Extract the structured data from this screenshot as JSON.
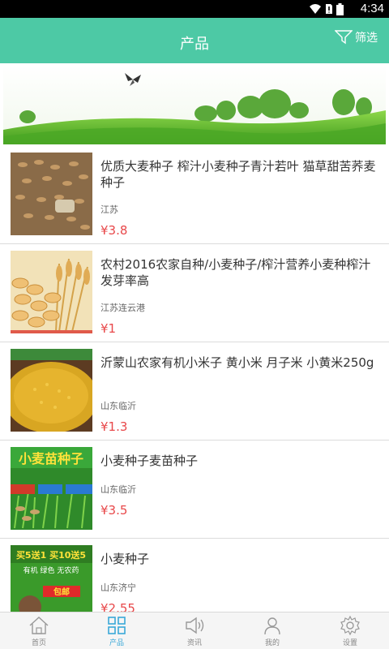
{
  "status_bar": {
    "time": "4:34"
  },
  "header": {
    "title": "产品",
    "filter_label": "筛选"
  },
  "products": [
    {
      "name": "优质大麦种子 榨汁小麦种子青汁若叶 猫草甜苦荞麦种子",
      "location": "江苏",
      "price": "¥3.8",
      "image": "barley-seeds-image"
    },
    {
      "name": "农村2016农家自种/小麦种子/榨汁营养小麦种榨汁 发芽率高",
      "location": "江苏连云港",
      "price": "¥1",
      "image": "wheat-grain-image"
    },
    {
      "name": "沂蒙山农家有机小米子 黄小米 月子米 小黄米250g",
      "location": "山东临沂",
      "price": "¥1.3",
      "image": "millet-image"
    },
    {
      "name": "小麦种子麦苗种子",
      "location": "山东临沂",
      "price": "¥3.5",
      "image": "wheat-sprout-seed-image"
    },
    {
      "name": "小麦种子",
      "location": "山东济宁",
      "price": "¥2.55",
      "image": "wheat-seed-promo-image"
    }
  ],
  "thumb_text": {
    "p4_title": "小麦苗种子",
    "p5_line1": "买5送1 买10送5",
    "p5_line2": "有机 绿色 无农药",
    "p5_line3": "包邮"
  },
  "bottom_nav": [
    {
      "label": "首页",
      "icon": "home-icon",
      "active": false
    },
    {
      "label": "产品",
      "icon": "grid-icon",
      "active": true
    },
    {
      "label": "资讯",
      "icon": "speaker-icon",
      "active": false
    },
    {
      "label": "我的",
      "icon": "user-icon",
      "active": false
    },
    {
      "label": "设置",
      "icon": "gear-icon",
      "active": false
    }
  ],
  "colors": {
    "header": "#4dc9a5",
    "price": "#e8484a",
    "nav_active": "#3aa8d8"
  }
}
